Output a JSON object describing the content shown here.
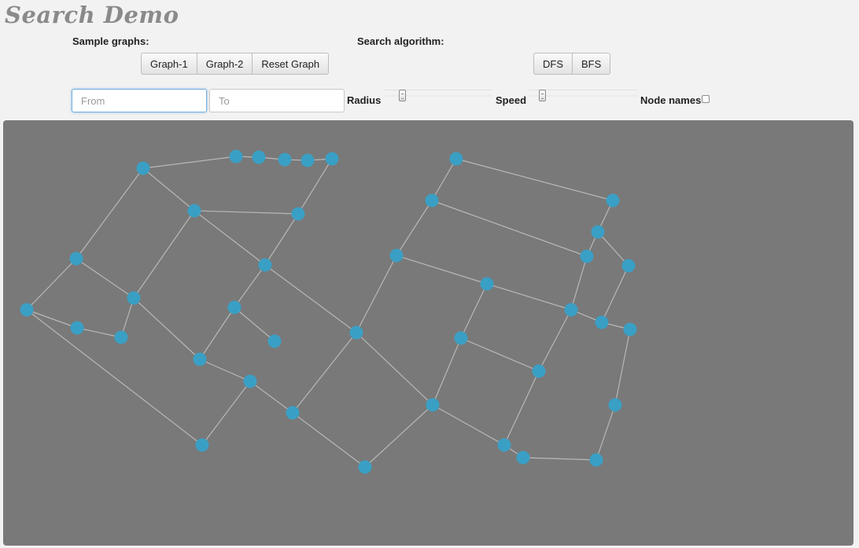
{
  "app": {
    "title": "Search Demo"
  },
  "sample_graphs": {
    "label": "Sample graphs:",
    "buttons": [
      "Graph-1",
      "Graph-2",
      "Reset Graph"
    ]
  },
  "search_algorithm": {
    "label": "Search algorithm:",
    "buttons": [
      "DFS",
      "BFS"
    ]
  },
  "inputs": {
    "from": {
      "placeholder": "From",
      "value": ""
    },
    "to": {
      "placeholder": "To",
      "value": ""
    }
  },
  "controls": {
    "radius_label": "Radius",
    "radius_value": 0.15,
    "speed_label": "Speed",
    "speed_value": 0.1,
    "node_names_label": "Node names",
    "node_names_checked": false
  },
  "colors": {
    "canvas_bg": "#797979",
    "node": "#3a9fc4",
    "edge": "#b8b8b8"
  }
}
